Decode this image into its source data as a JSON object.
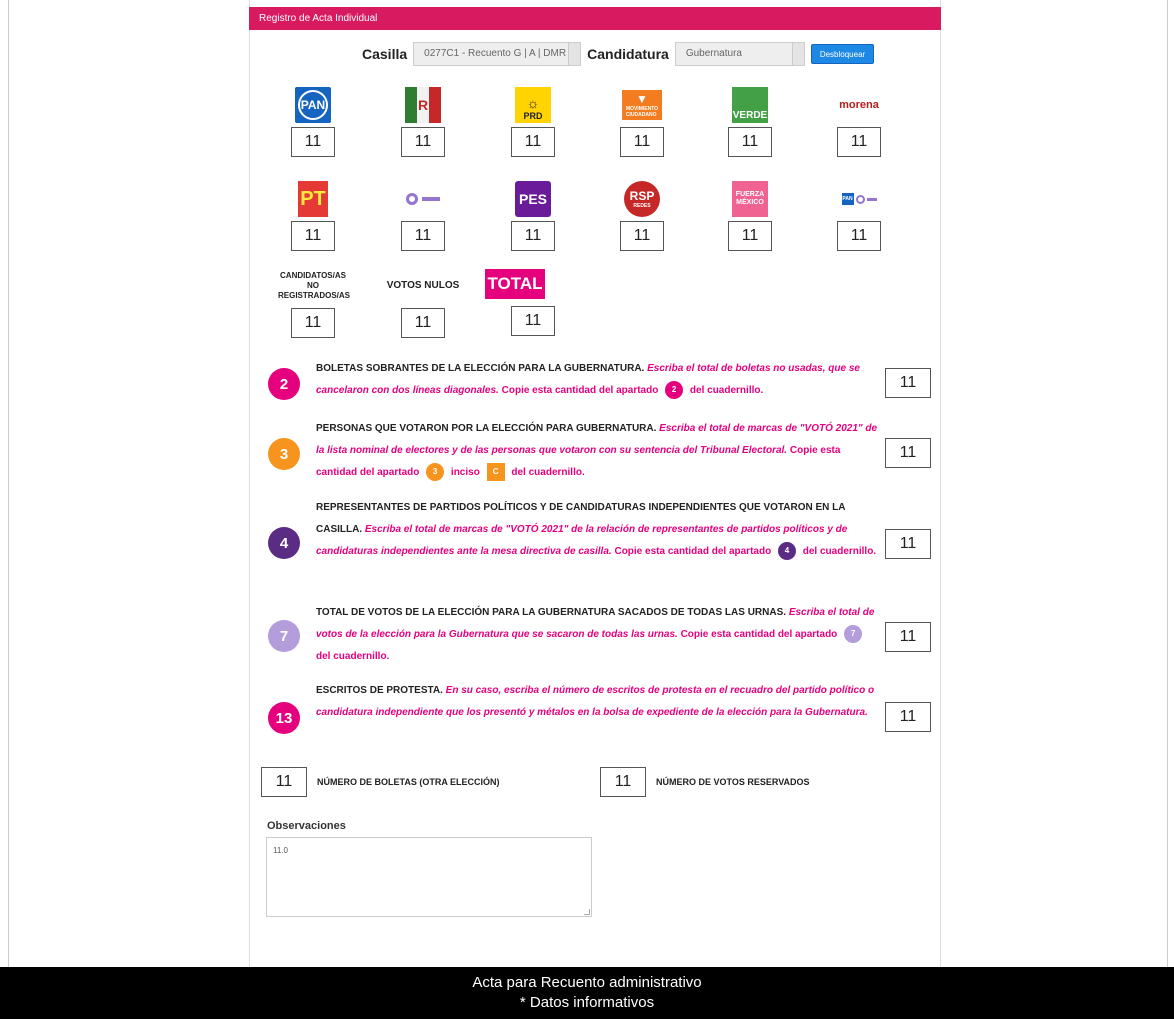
{
  "header": {
    "title": "Registro de Acta Individual"
  },
  "selectors": {
    "casilla_label": "Casilla",
    "casilla_value": "0277C1 - Recuento G | A | DMR |",
    "candidatura_label": "Candidatura",
    "candidatura_value": "Gubernatura",
    "unlock_label": "Desbloquear"
  },
  "parties_row1": [
    {
      "name": "PAN",
      "value": "11",
      "icon": "pan-logo-icon"
    },
    {
      "name": "PRI",
      "value": "11",
      "icon": "pri-logo-icon"
    },
    {
      "name": "PRD",
      "value": "11",
      "icon": "prd-logo-icon"
    },
    {
      "name": "MOVIMIENTO CIUDADANO",
      "value": "11",
      "icon": "movimiento-ciudadano-logo-icon"
    },
    {
      "name": "VERDE",
      "value": "11",
      "icon": "verde-logo-icon"
    },
    {
      "name": "morena",
      "value": "11",
      "icon": "morena-logo-icon"
    }
  ],
  "parties_row2": [
    {
      "name": "PT",
      "value": "11",
      "icon": "pt-logo-icon"
    },
    {
      "name": "MOVIMIENTO PROGRESISTA",
      "value": "11",
      "icon": "movimiento-progresista-logo-icon"
    },
    {
      "name": "PES",
      "value": "11",
      "icon": "pes-logo-icon"
    },
    {
      "name": "RSP",
      "value": "11",
      "icon": "rsp-logo-icon"
    },
    {
      "name": "FUERZA MÉXICO",
      "value": "11",
      "icon": "fuerza-mexico-logo-icon"
    },
    {
      "name": "PAN coalición",
      "value": "11",
      "icon": "coalition-logo-icon"
    }
  ],
  "row3": {
    "no_registrados_label": "CANDIDATOS/AS NO REGISTRADOS/AS",
    "no_registrados_value": "11",
    "nulos_label": "VOTOS NULOS",
    "nulos_value": "11",
    "total_label": "TOTAL",
    "total_value": "11"
  },
  "sections": [
    {
      "number": "2",
      "color": "#e5007e",
      "bold": "BOLETAS SOBRANTES DE LA ELECCIÓN PARA LA GUBERNATURA.",
      "italic": "Escriba el total de boletas no usadas, que se cancelaron con dos líneas diagonales.",
      "copy": "Copie esta cantidad del apartado",
      "tail": "del cuadernillo.",
      "value": "11"
    },
    {
      "number": "3",
      "color": "#f7941d",
      "bold": "PERSONAS QUE VOTARON POR LA ELECCIÓN PARA GUBERNATURA.",
      "italic": "Escriba el total de marcas de \"VOTÓ 2021\" de la lista nominal de electores y de las personas que votaron con su sentencia del Tribunal Electoral.",
      "copy": "Copie esta cantidad del apartado",
      "inciso": "inciso",
      "inciso_letter": "C",
      "tail": "del cuadernillo.",
      "value": "11"
    },
    {
      "number": "4",
      "color": "#5b2c83",
      "bold": "REPRESENTANTES DE PARTIDOS POLÍTICOS Y DE CANDIDATURAS INDEPENDIENTES QUE VOTARON EN LA CASILLA.",
      "italic": "Escriba el total de marcas de \"VOTÓ 2021\" de la relación de representantes de partidos políticos y de candidaturas independientes ante la mesa directiva de casilla.",
      "copy": "Copie esta cantidad del apartado",
      "tail": "del cuadernillo.",
      "value": "11"
    },
    {
      "number": "7",
      "color": "#b39ddb",
      "bold": "TOTAL DE VOTOS DE LA ELECCIÓN PARA LA GUBERNATURA SACADOS DE TODAS LAS URNAS.",
      "italic": "Escriba el total de votos de la elección para la Gubernatura que se sacaron de todas las urnas.",
      "copy": "Copie esta cantidad del apartado",
      "tail": "del cuadernillo.",
      "value": "11"
    },
    {
      "number": "13",
      "color": "#e5007e",
      "bold": "ESCRITOS DE PROTESTA.",
      "italic": "En su caso, escriba el número de escritos de protesta en el recuadro del partido político o candidatura independiente que los presentó y métalos en la bolsa de expediente de la elección para la Gubernatura.",
      "value": "11"
    }
  ],
  "bottom": {
    "boletas_value": "11",
    "boletas_label": "NÚMERO DE BOLETAS (OTRA ELECCIÓN)",
    "reservados_value": "11",
    "reservados_label": "NÚMERO DE VOTOS RESERVADOS"
  },
  "observaciones": {
    "label": "Observaciones",
    "value": "11.0"
  },
  "footer": {
    "line1": "Acta para Recuento administrativo",
    "line2": "* Datos informativos"
  }
}
